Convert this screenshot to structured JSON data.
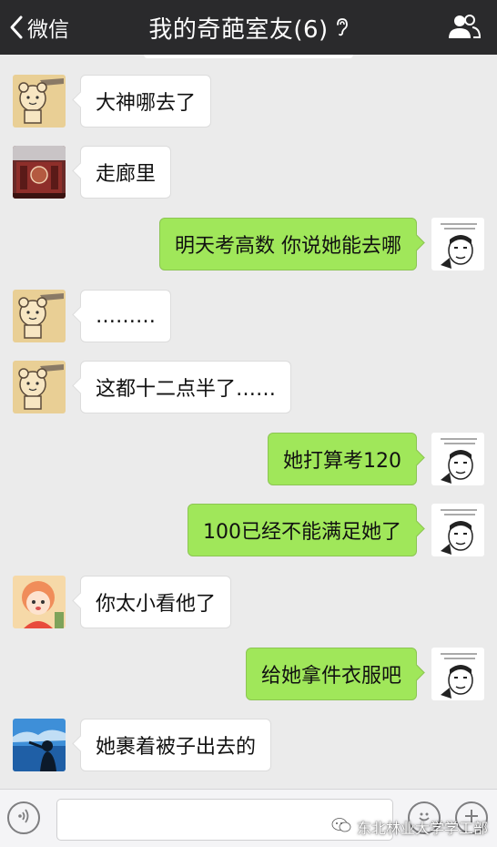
{
  "header": {
    "back_label": "微信",
    "title": "我的奇葩室友(6)"
  },
  "messages": [
    {
      "side": "left",
      "avatar": "cartoon-bear",
      "text": "大神哪去了"
    },
    {
      "side": "left",
      "avatar": "building",
      "text": "走廊里"
    },
    {
      "side": "right",
      "avatar": "meme-face",
      "text": "明天考高数 你说她能去哪"
    },
    {
      "side": "left",
      "avatar": "cartoon-bear",
      "text": "………"
    },
    {
      "side": "left",
      "avatar": "cartoon-bear",
      "text": "这都十二点半了……"
    },
    {
      "side": "right",
      "avatar": "meme-face",
      "text": "她打算考120"
    },
    {
      "side": "right",
      "avatar": "meme-face",
      "text": "100已经不能满足她了"
    },
    {
      "side": "left",
      "avatar": "cartoon-girl",
      "text": "你太小看他了"
    },
    {
      "side": "right",
      "avatar": "meme-face",
      "text": "给她拿件衣服吧"
    },
    {
      "side": "left",
      "avatar": "sky-silhouette",
      "text": "她裹着被子出去的"
    }
  ],
  "watermark": {
    "text": "东北林业大学学工部"
  },
  "colors": {
    "navbar": "#2a2a2c",
    "background": "#ebebeb",
    "sent_bubble": "#a0e75a",
    "received_bubble": "#ffffff"
  }
}
